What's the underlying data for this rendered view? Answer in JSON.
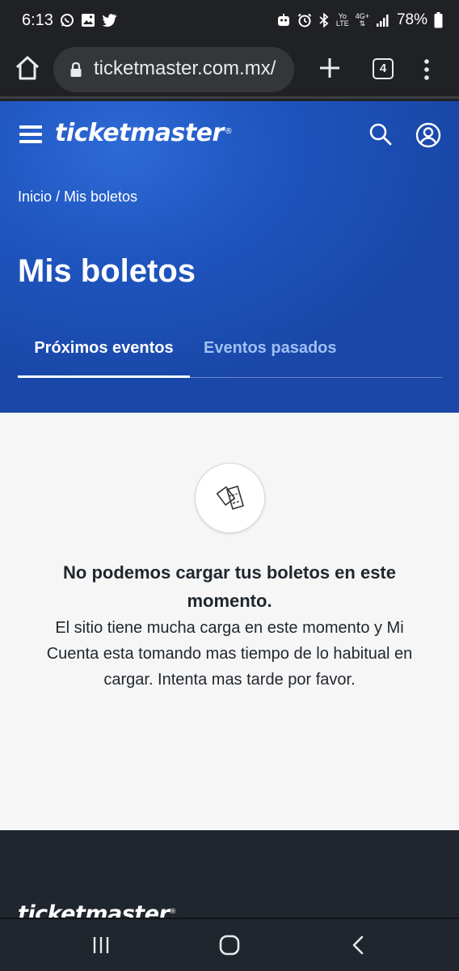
{
  "status_bar": {
    "time": "6:13",
    "battery": "78%",
    "net_yo": "Yo",
    "net_lte": "LTE",
    "net_4g": "4G+"
  },
  "browser": {
    "url": "ticketmaster.com.mx/",
    "tab_count": "4"
  },
  "header": {
    "logo_text": "ticketmaster",
    "logo_mark": "®",
    "breadcrumb": "Inicio / Mis boletos",
    "title": "Mis boletos",
    "tabs": [
      {
        "label": "Próximos eventos",
        "active": true
      },
      {
        "label": "Eventos pasados",
        "active": false
      }
    ]
  },
  "message": {
    "icon": "tickets-icon",
    "title": "No podemos cargar tus boletos en este momento.",
    "body": "El sitio tiene mucha carga en este momento y Mi Cuenta esta tomando mas tiempo de lo habitual en cargar. Intenta mas tarde por favor."
  },
  "footer": {
    "logo_text": "ticketmaster",
    "logo_mark": "®"
  },
  "colors": {
    "header_blue": "#1f55bf",
    "content_bg": "#f6f6f6",
    "footer_bg": "#1f262d",
    "inactive_tab": "#9fc0f5"
  }
}
